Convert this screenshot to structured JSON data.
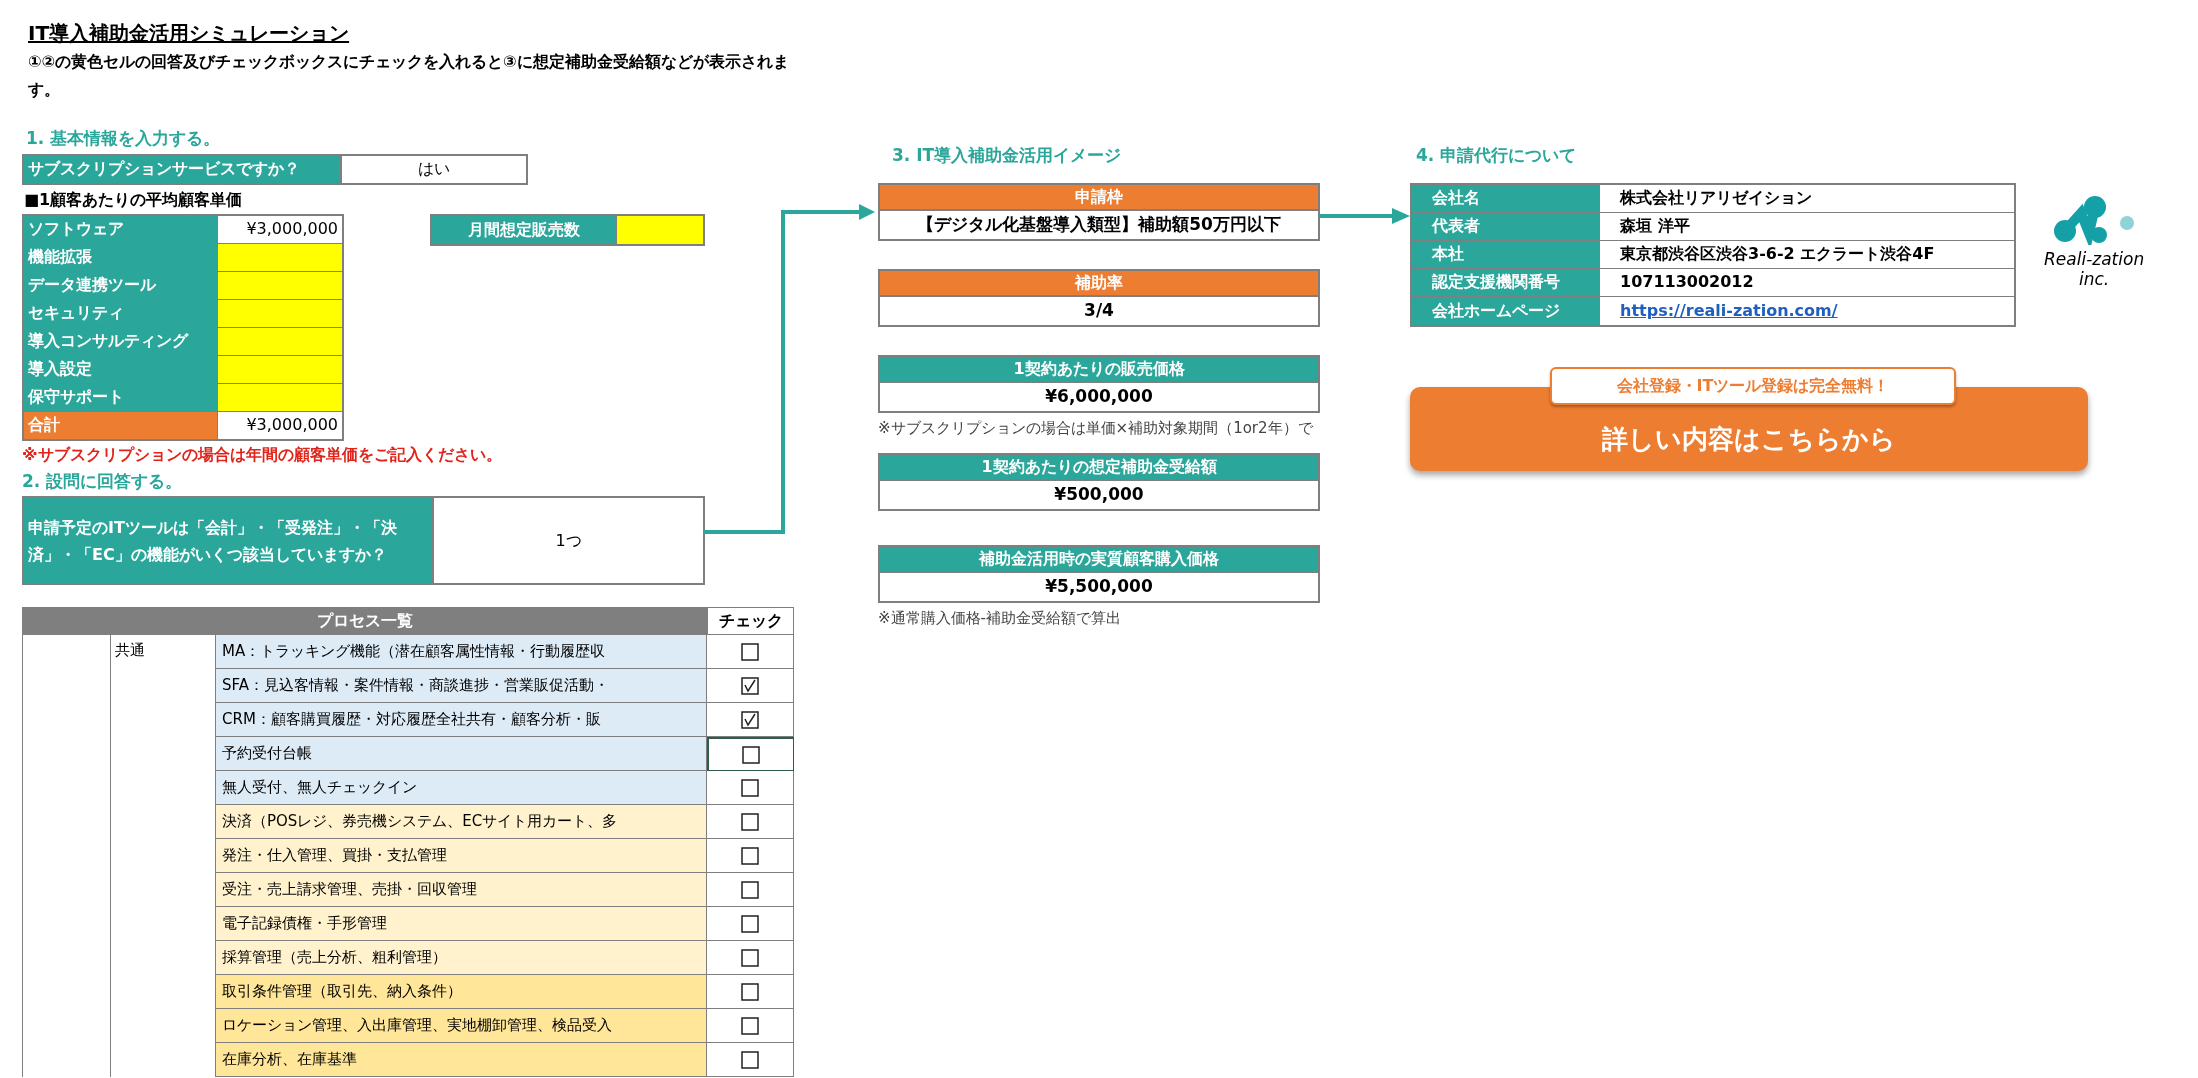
{
  "title": "IT導入補助金活用シミュレーション",
  "instructions": "①②の黄色セルの回答及びチェックボックスにチェックを入れると③に想定補助金受給額などが表示されます。",
  "section1": {
    "heading": "1. 基本情報を入力する。",
    "subscription": {
      "label": "サブスクリプションサービスですか？",
      "value": "はい"
    },
    "price_heading": "■1顧客あたりの平均顧客単価",
    "price_rows": [
      {
        "label": "ソフトウェア",
        "value": "¥3,000,000",
        "kind": "amount"
      },
      {
        "label": "機能拡張",
        "kind": "entry"
      },
      {
        "label": "データ連携ツール",
        "kind": "entry"
      },
      {
        "label": "セキュリティ",
        "kind": "entry"
      },
      {
        "label": "導入コンサルティング",
        "kind": "entry"
      },
      {
        "label": "導入設定",
        "kind": "entry"
      },
      {
        "label": "保守サポート",
        "kind": "entry"
      },
      {
        "label": "合計",
        "value": "¥3,000,000",
        "kind": "total"
      }
    ],
    "monthly_sales": {
      "label": "月間想定販売数"
    },
    "note": "※サブスクリプションの場合は年間の顧客単価をご記入ください。"
  },
  "section2": {
    "heading": "2. 設問に回答する。",
    "question": "申請予定のITツールは「会計」・「受発注」・「決済」・「EC」の機能がいくつ該当していますか？",
    "answer": "1つ"
  },
  "process_table": {
    "header": "プロセス一覧",
    "check_header": "チェック",
    "group": "共通",
    "rows": [
      {
        "label": "MA：トラッキング機能（潜在顧客属性情報・行動履歴収",
        "checked": false,
        "selected": false,
        "color": "#ddebf7"
      },
      {
        "label": "SFA：見込客情報・案件情報・商談進捗・営業販促活動・",
        "checked": true,
        "selected": false,
        "color": "#ddebf7"
      },
      {
        "label": "CRM：顧客購買履歴・対応履歴全社共有・顧客分析・販",
        "checked": true,
        "selected": false,
        "color": "#ddebf7"
      },
      {
        "label": "予約受付台帳",
        "checked": false,
        "selected": true,
        "color": "#ddebf7"
      },
      {
        "label": "無人受付、無人チェックイン",
        "checked": false,
        "selected": false,
        "color": "#ddebf7"
      },
      {
        "label": "決済（POSレジ、券売機システム、ECサイト用カート、多",
        "checked": false,
        "selected": false,
        "color": "#fff2cc"
      },
      {
        "label": "発注・仕入管理、買掛・支払管理",
        "checked": false,
        "selected": false,
        "color": "#fff2cc"
      },
      {
        "label": "受注・売上請求管理、売掛・回収管理",
        "checked": false,
        "selected": false,
        "color": "#fff2cc"
      },
      {
        "label": "電子記録債権・手形管理",
        "checked": false,
        "selected": false,
        "color": "#fff2cc"
      },
      {
        "label": "採算管理（売上分析、粗利管理）",
        "checked": false,
        "selected": false,
        "color": "#fff2cc"
      },
      {
        "label": "取引条件管理（取引先、納入条件）",
        "checked": false,
        "selected": false,
        "color": "#ffe699"
      },
      {
        "label": "ロケーション管理、入出庫管理、実地棚卸管理、検品受入",
        "checked": false,
        "selected": false,
        "color": "#ffe699"
      },
      {
        "label": "在庫分析、在庫基準",
        "checked": false,
        "selected": false,
        "color": "#ffe699"
      }
    ]
  },
  "section3": {
    "heading": "3. IT導入補助金活用イメージ",
    "blocks": [
      {
        "label": "申請枠",
        "value": "【デジタル化基盤導入類型】補助額50万円以下",
        "kind": "orange"
      },
      {
        "label": "補助率",
        "value": "3/4",
        "kind": "orange"
      },
      {
        "label": "1契約あたりの販売価格",
        "value": "¥6,000,000",
        "kind": "teal",
        "note": "※サブスクリプションの場合は単価×補助対象期間（1or2年）で"
      },
      {
        "label": "1契約あたりの想定補助金受給額",
        "value": "¥500,000",
        "kind": "teal"
      },
      {
        "label": "補助金活用時の実質顧客購入価格",
        "value": "¥5,500,000",
        "kind": "teal",
        "note": "※通常購入価格-補助金受給額で算出"
      }
    ]
  },
  "section4": {
    "heading": "4. 申請代行について",
    "rows": [
      {
        "label": "会社名",
        "value": "株式会社リアリゼイション",
        "kind": "text"
      },
      {
        "label": "代表者",
        "value": "森垣 洋平",
        "kind": "text"
      },
      {
        "label": "本社",
        "value": "東京都渋谷区渋谷3-6-2 エクラート渋谷4F",
        "kind": "text"
      },
      {
        "label": "認定支援機関番号",
        "value": "107113002012",
        "kind": "text"
      },
      {
        "label": "会社ホームページ",
        "value": "https://reali-zation.com/",
        "kind": "link"
      }
    ]
  },
  "logo": {
    "name": "Reali-zation",
    "suffix": "inc."
  },
  "cta": {
    "tag": "会社登録・ITツール登録は完全無料！",
    "button": "詳しい内容はこちらから"
  }
}
